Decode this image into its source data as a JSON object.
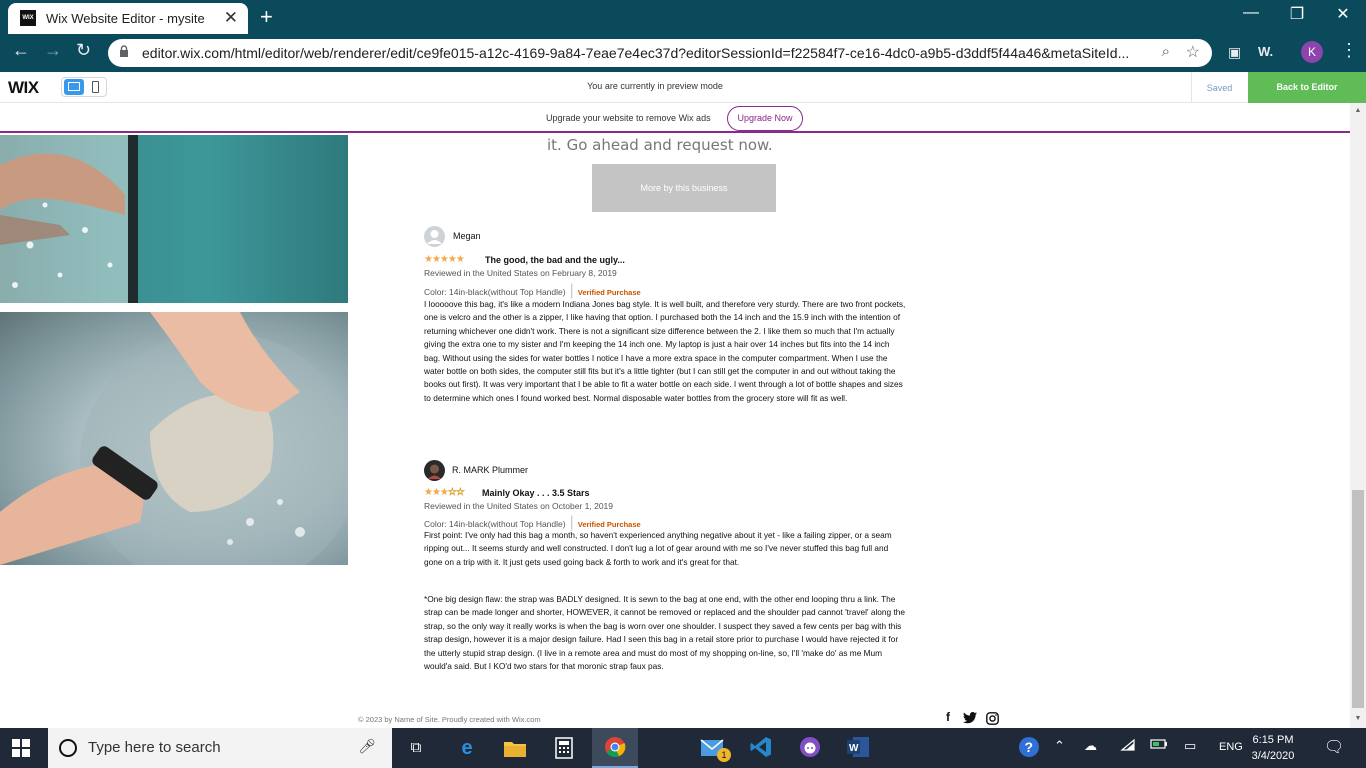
{
  "browser": {
    "tab_title": "Wix Website Editor - mysite",
    "tab_favicon_text": "WIX",
    "url": "editor.wix.com/html/editor/web/renderer/edit/ce9fe015-a12c-4169-9a84-7eae7e4ec37d?editorSessionId=f22584f7-ce16-4dc0-a9b5-d3ddf5f44a46&metaSiteId...",
    "profile_initial": "K",
    "extension_w": "W."
  },
  "wix": {
    "logo": "WIX",
    "preview_notice": "You are currently in preview mode",
    "saved_label": "Saved",
    "back_label": "Back to Editor",
    "upgrade_text": "Upgrade your website to remove Wix ads",
    "upgrade_button": "Upgrade Now"
  },
  "page": {
    "tagline": "it. Go ahead and request now.",
    "more_button": "More by this business",
    "footer": "© 2023 by Name of Site. Proudly created with Wix.com",
    "social": [
      "f",
      "t",
      "ig"
    ]
  },
  "reviews": [
    {
      "name": "Megan",
      "rating": 5,
      "stars_text": "★★★★★",
      "title": "The good, the bad and the ugly...",
      "meta": "Reviewed in the United States on February 8, 2019",
      "color": "Color: 14in-black(without Top Handle)",
      "verified": "Verified Purchase",
      "body": "I looooove this bag, it's like a modern Indiana Jones bag style. It is well built, and therefore very sturdy. There are two front pockets, one is velcro and the other is a zipper, I like having that option. I purchased both the 14 inch and the 15.9 inch with the intention of returning whichever one didn't work. There is not a significant size difference between the 2. I like them so much that I'm actually giving the extra one to my sister and I'm keeping the 14 inch one. My laptop is just a hair over 14 inches but fits into the 14 inch bag. Without using the sides for water bottles I notice I have a more extra space in the computer compartment. When I use the water bottle on both sides, the computer still fits but it's a little tighter (but I can still get the computer in and out without taking the books out first). It was very important that I be able to fit a water bottle on each side. I went through a lot of bottle shapes and sizes to determine which ones I found worked best. Normal disposable water bottles from the grocery store will fit as well."
    },
    {
      "name": "R. MARK Plummer",
      "rating": 3.5,
      "stars_text": "★★★",
      "stars_off_text": "☆☆",
      "title": "Mainly Okay . . . 3.5 Stars",
      "meta": "Reviewed in the United States on October 1, 2019",
      "color": "Color: 14in-black(without Top Handle)",
      "verified": "Verified Purchase",
      "body": "First point: I've only had this bag a month, so haven't experienced anything negative about it yet - like a failing zipper, or a seam ripping out... It seems sturdy and well constructed. I don't lug a lot of gear around with me so I've never stuffed this bag full and gone on a trip with it. It just gets used going back & forth to work and it's great for that.",
      "body2": "*One big design flaw: the strap was BADLY designed. It is sewn to the bag at one end, with the other end looping thru a link. The strap can be made longer and shorter, HOWEVER, it cannot be removed or replaced and the shoulder pad cannot 'travel' along the strap, so the only way it really works is when the bag is worn over one shoulder. I suspect they saved a few cents per bag with this strap design, however it is a major design failure. Had I seen this bag in a retail store prior to purchase I would have rejected it for the utterly stupid strap design. (I live in a remote area and must do most of my shopping on-line, so, I'll 'make do' as me Mum would'a said. But I KO'd two stars for that moronic strap faux pas."
    }
  ],
  "taskbar": {
    "search_placeholder": "Type here to search",
    "language": "ENG",
    "time": "6:15 PM",
    "date": "3/4/2020",
    "mail_badge": "1"
  }
}
